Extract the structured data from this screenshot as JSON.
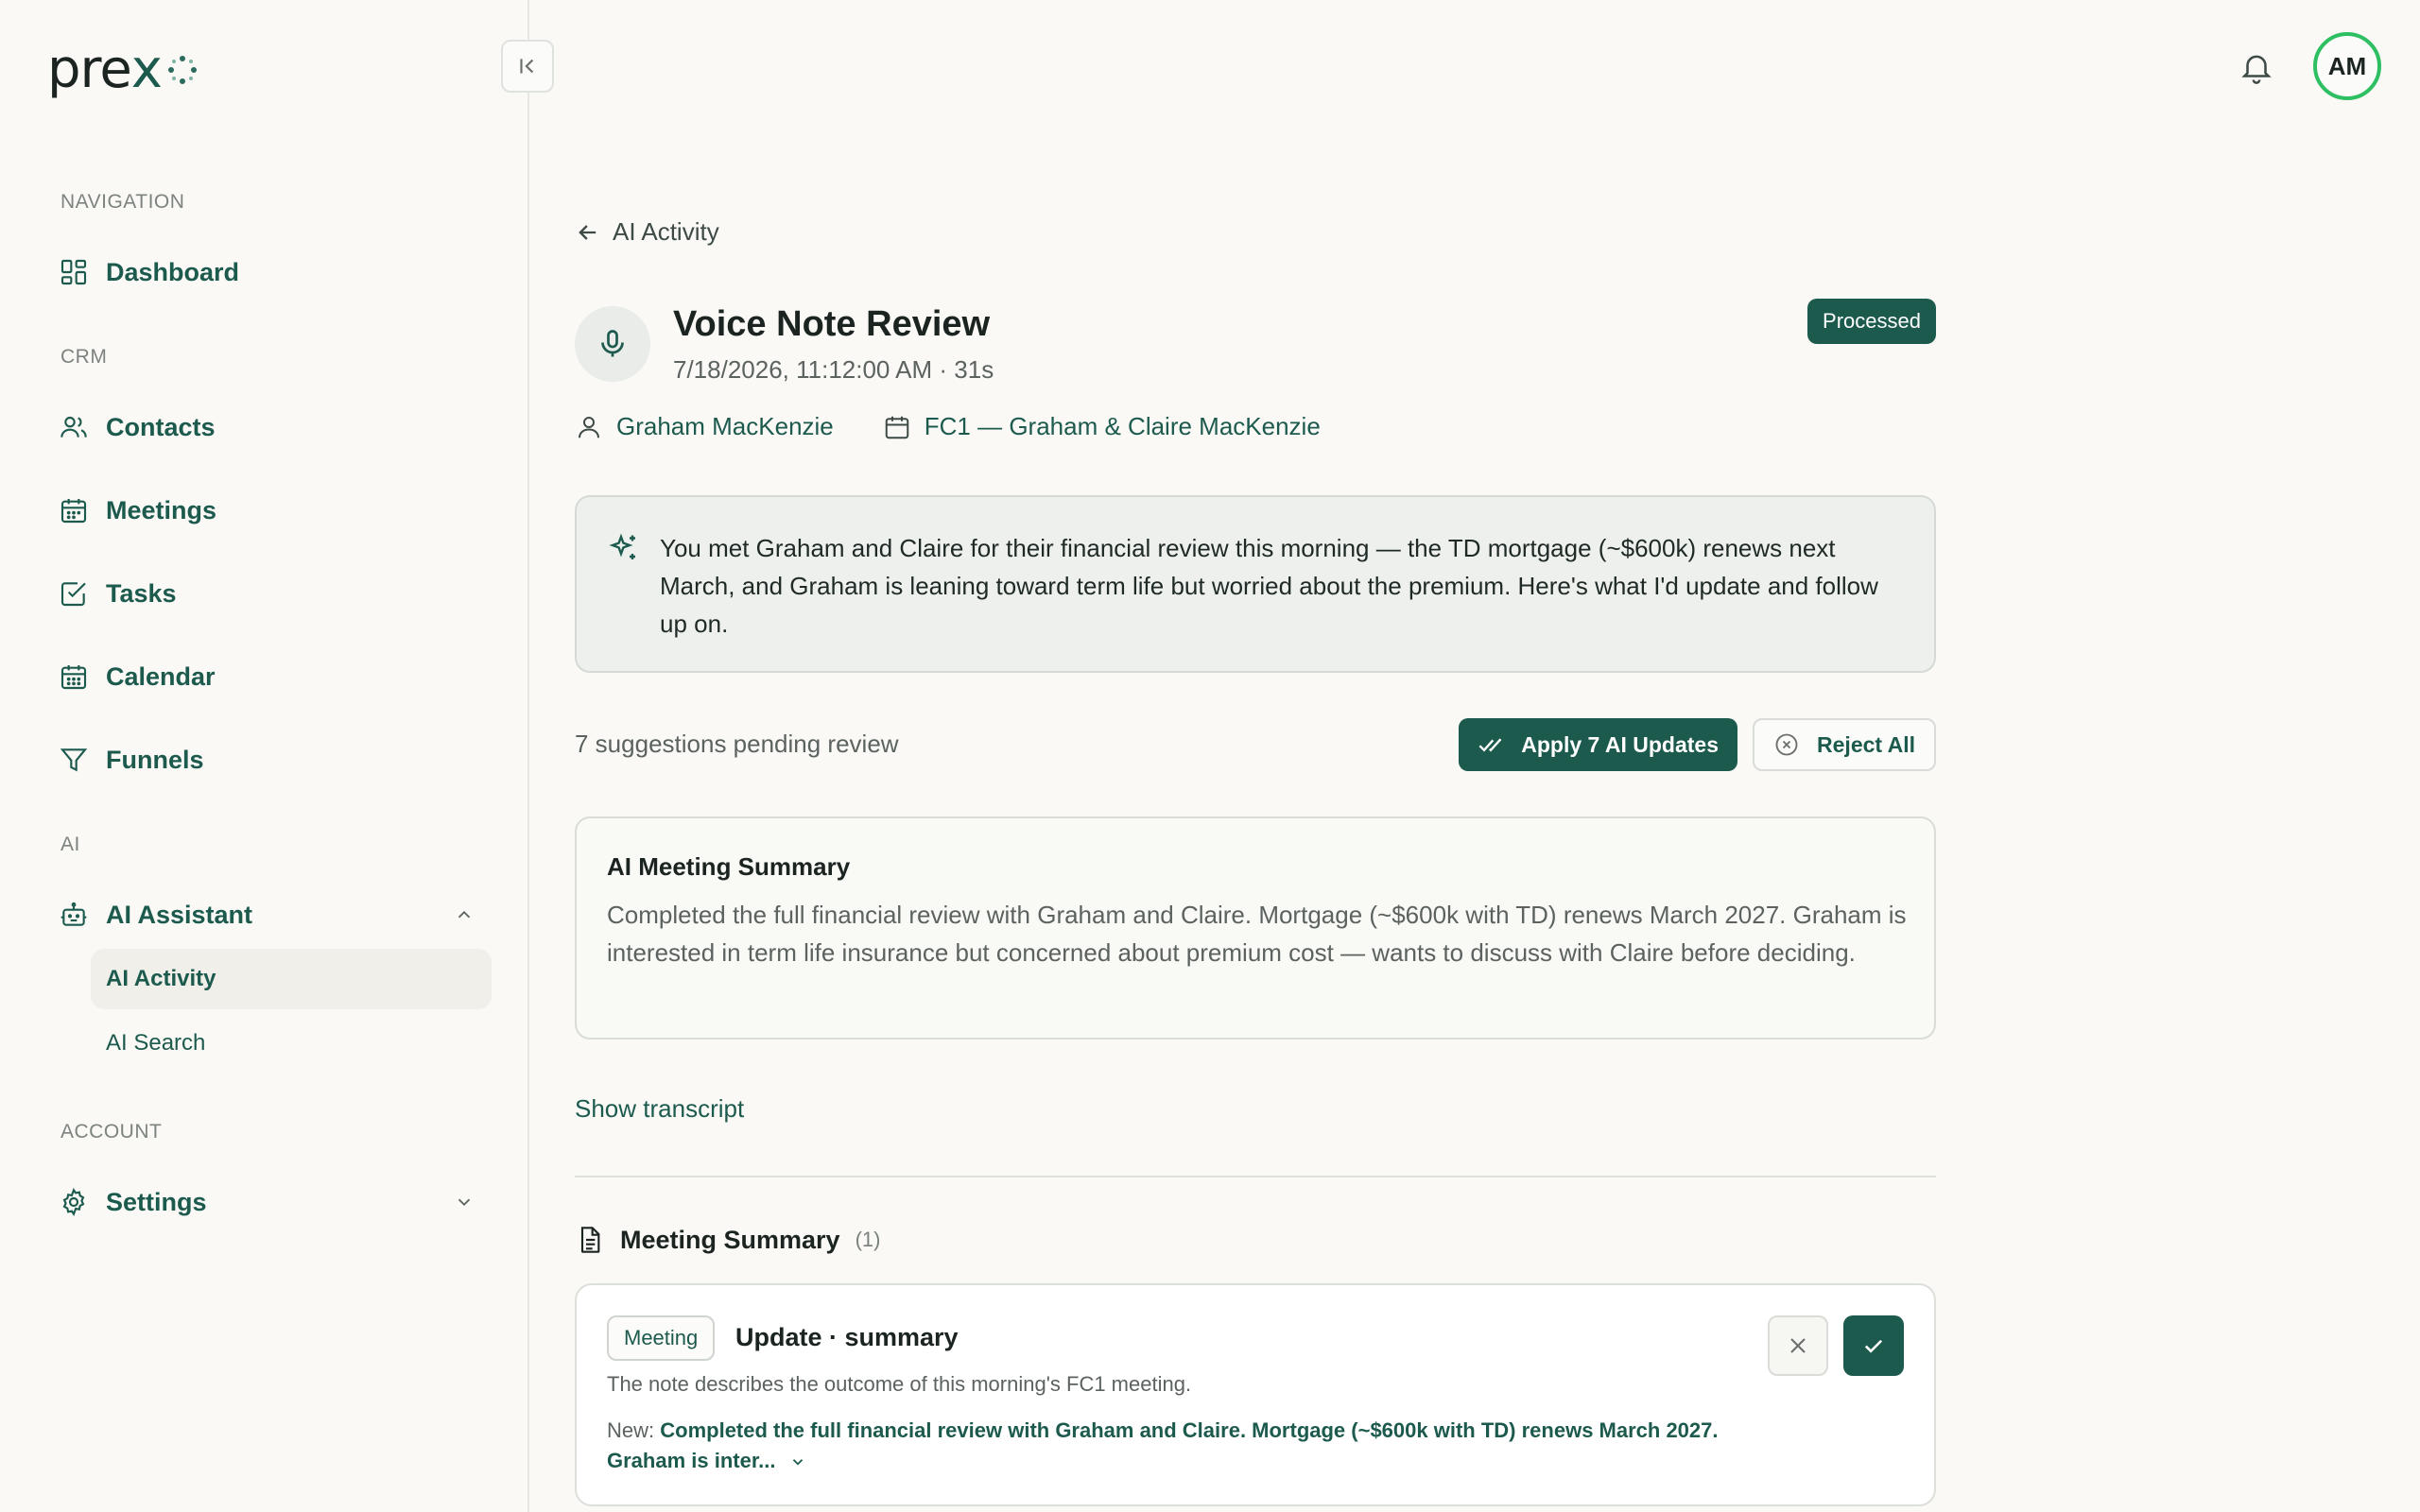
{
  "brand": {
    "logo_text": "pre",
    "logo_x": "x"
  },
  "sidebar": {
    "sections": {
      "navigation": "NAVIGATION",
      "crm": "CRM",
      "ai": "AI",
      "account": "ACCOUNT"
    },
    "items": {
      "dashboard": "Dashboard",
      "contacts": "Contacts",
      "meetings": "Meetings",
      "tasks": "Tasks",
      "calendar": "Calendar",
      "funnels": "Funnels",
      "ai_assistant": "AI Assistant",
      "ai_activity": "AI Activity",
      "ai_search": "AI Search",
      "settings": "Settings"
    }
  },
  "topbar": {
    "avatar_initials": "AM"
  },
  "page": {
    "back_label": "AI Activity",
    "title": "Voice Note Review",
    "subtitle": "7/18/2026, 11:12:00 AM · 31s",
    "status": "Processed",
    "contact": "Graham MacKenzie",
    "meeting_ref": "FC1 — Graham & Claire MacKenzie",
    "ai_summary": "You met Graham and Claire for their financial review this morning — the TD mortgage (~$600k) renews next March, and Graham is leaning toward term life but worried about the premium. Here's what I'd update and follow up on.",
    "pending_text": "7 suggestions pending review",
    "apply_label": "Apply 7 AI Updates",
    "reject_label": "Reject All",
    "meeting_card": {
      "title": "AI Meeting Summary",
      "body": "Completed the full financial review with Graham and Claire. Mortgage (~$600k with TD) renews March 2027. Graham is interested in term life insurance but concerned about premium cost — wants to discuss with Claire before deciding."
    },
    "show_transcript": "Show transcript",
    "section": {
      "title": "Meeting Summary",
      "count": "(1)"
    },
    "update": {
      "tag": "Meeting",
      "title": "Update · summary",
      "description": "The note describes the outcome of this morning's FC1 meeting.",
      "new_label": "New:",
      "new_value": "Completed the full financial review with Graham and Claire. Mortgage (~$600k with TD) renews March 2027. Graham is inter..."
    }
  },
  "colors": {
    "accent": "#1d5a4e",
    "avatar_ring": "#2fbf63"
  }
}
